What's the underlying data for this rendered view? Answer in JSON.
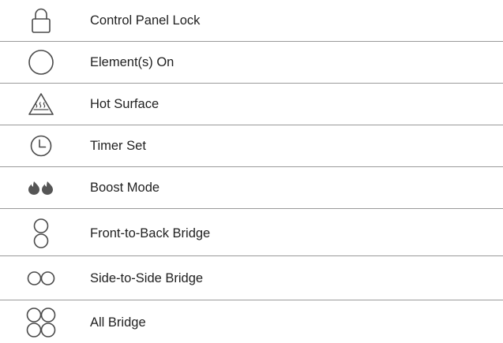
{
  "rows": [
    {
      "icon": "lock-icon",
      "label": "Control Panel Lock"
    },
    {
      "icon": "circle-icon",
      "label": "Element(s) On"
    },
    {
      "icon": "hot-surface-icon",
      "label": "Hot Surface"
    },
    {
      "icon": "clock-icon",
      "label": "Timer Set"
    },
    {
      "icon": "flames-icon",
      "label": "Boost Mode"
    },
    {
      "icon": "front-to-back-bridge-icon",
      "label": "Front-to-Back Bridge"
    },
    {
      "icon": "side-to-side-bridge-icon",
      "label": "Side-to-Side Bridge"
    },
    {
      "icon": "all-bridge-icon",
      "label": "All Bridge"
    }
  ],
  "colors": {
    "text": "#1f1f1f",
    "icon_stroke": "#4a4a4a",
    "divider": "#9a9a9a",
    "flame_fill": "#555555"
  }
}
